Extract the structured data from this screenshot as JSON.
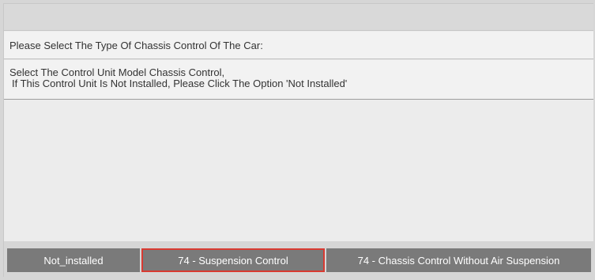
{
  "dialog": {
    "title": "",
    "prompt": "Please Select The Type Of Chassis Control Of The Car:",
    "message_line1": "Select The Control Unit Model Chassis Control,",
    "message_line2": "If This Control Unit Is Not Installed, Please Click The Option 'Not Installed'"
  },
  "buttons": {
    "not_installed": "Not_installed",
    "suspension_control": "74 - Suspension Control",
    "chassis_control_no_air": "74 - Chassis Control Without Air Suspension"
  },
  "colors": {
    "button_bg": "#7a7a7a",
    "button_text": "#ffffff",
    "highlight_border": "#d83a32",
    "panel_bg": "#ececec",
    "header_bg": "#d9d9d9"
  }
}
